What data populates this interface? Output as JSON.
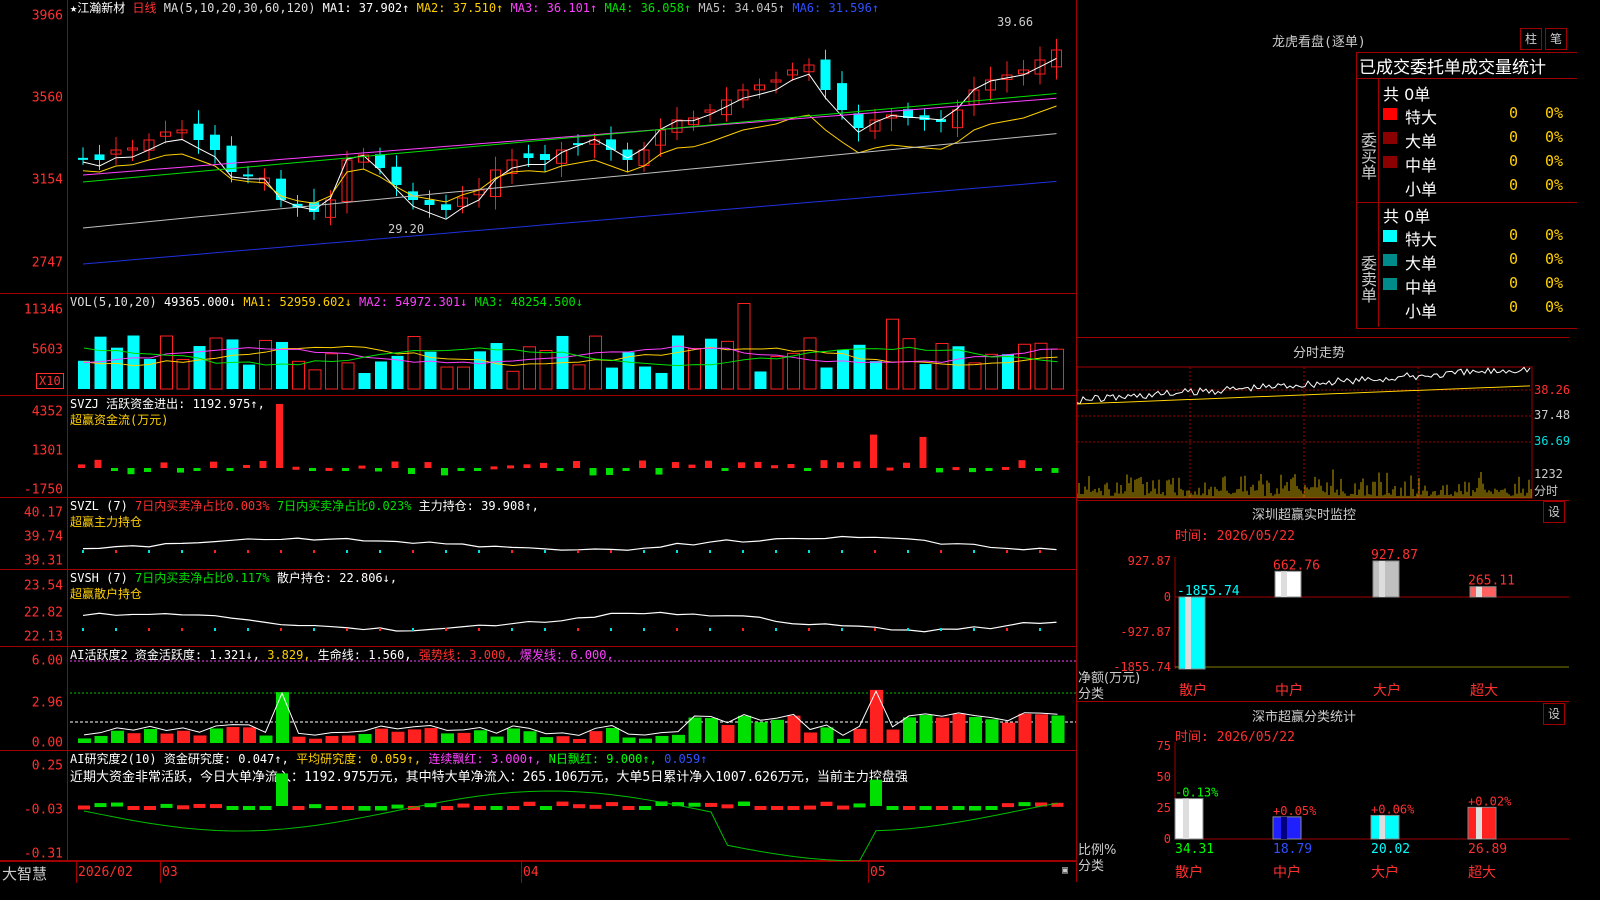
{
  "stock": {
    "name": "★江瀚新材",
    "period": "日线",
    "ma_label": "MA(5,10,20,30,60,120)",
    "ma1": "MA1: 37.902↑",
    "ma2": "MA2: 37.510↑",
    "ma3": "MA3: 36.101↑",
    "ma4": "MA4: 36.058↑",
    "ma5": "MA5: 34.045↑",
    "ma6": "MA6: 31.596↑",
    "max_label": "39.66",
    "min_label": "29.20"
  },
  "price_axis": [
    "3966",
    "3560",
    "3154",
    "2747"
  ],
  "vol": {
    "label": "VOL(5,10,20)",
    "v": "49365.000↓",
    "ma1": "MA1: 52959.602↓",
    "ma2": "MA2: 54972.301↓",
    "ma3": "MA3: 48254.500↓",
    "axis": [
      "11346",
      "5603"
    ],
    "x10": "X10"
  },
  "svzj": {
    "label": "SVZJ  活跃资金进出: 1192.975↑,",
    "sub": "超赢资金流(万元)",
    "axis": [
      "4352",
      "1301",
      "-1750"
    ]
  },
  "svzl": {
    "label": "SVZL (7)",
    "part1": "7日内买卖净占比0.003%",
    "part2": "7日内买卖净占比0.023%",
    "part3": "主力持仓: 39.908↑,",
    "sub": "超赢主力持仓",
    "axis": [
      "40.17",
      "39.74",
      "39.31"
    ]
  },
  "svsh": {
    "label": "SVSH (7)",
    "part1": "7日内买卖净占比0.117%",
    "part2": "散户持仓: 22.806↓,",
    "sub": "超赢散户持仓",
    "axis": [
      "23.54",
      "22.82",
      "22.13"
    ]
  },
  "ai1": {
    "label": "AI活跃度2",
    "p1": "资金活跃度: 1.321↓,",
    "p2": "3.829,",
    "p3": "生命线: 1.560,",
    "p4": "强势线: 3.000,",
    "p5": "爆发线: 6.000,",
    "axis": [
      "6.00",
      "2.96",
      "0.00"
    ]
  },
  "ai2": {
    "label": "AI研究度2(10)",
    "p1": "资金研究度: 0.047↑,",
    "p2": "平均研究度: 0.059↑,",
    "p3": "连续飘红: 3.000↑,",
    "p4": "N日飘红: 9.000↑,",
    "p5": "0.059↑",
    "text": "近期大资金非常活跃，今日大单净流入：1192.975万元，其中特大单净流入：265.106万元，大单5日累计净入1007.626万元，当前主力控盘强",
    "axis": [
      "0.25",
      "-0.03",
      "-0.31"
    ]
  },
  "footer": {
    "brand": "大智慧",
    "d1": "2026/02",
    "d2": "03",
    "d3": "04",
    "d4": "05"
  },
  "lhb": {
    "title": "龙虎看盘(逐单)",
    "btn1": "柱",
    "btn2": "笔",
    "heading": "已成交委托单成交量统计",
    "buy_side": "委买单",
    "sell_side": "委卖单",
    "buy_total": "共 0单",
    "sell_total": "共 0单",
    "buy_rows": [
      {
        "label": "特大",
        "v": "0",
        "p": "0%",
        "color": "#ff0000"
      },
      {
        "label": "大单",
        "v": "0",
        "p": "0%",
        "color": "#8b0000"
      },
      {
        "label": "中单",
        "v": "0",
        "p": "0%",
        "color": "#8b0000"
      },
      {
        "label": "小单",
        "v": "0",
        "p": "0%",
        "color": "#000000"
      }
    ],
    "sell_rows": [
      {
        "label": "特大",
        "v": "0",
        "p": "0%",
        "color": "#00ffff"
      },
      {
        "label": "大单",
        "v": "0",
        "p": "0%",
        "color": "#008b8b"
      },
      {
        "label": "中单",
        "v": "0",
        "p": "0%",
        "color": "#008b8b"
      },
      {
        "label": "小单",
        "v": "0",
        "p": "0%",
        "color": "#000000"
      }
    ]
  },
  "fenshi": {
    "title": "分时走势",
    "axis": [
      "38.26",
      "37.48",
      "36.69",
      "1232",
      "分时"
    ]
  },
  "sz_monitor": {
    "title": "深圳超赢实时监控",
    "btn": "设",
    "time": "时间: 2026/05/22",
    "axis": [
      "927.87",
      "0",
      "-927.87",
      "-1855.74"
    ],
    "ylab": "净额(万元)",
    "xlab": "分类",
    "cats": [
      "散户",
      "中户",
      "大户",
      "超大"
    ],
    "values": [
      -1855.74,
      662.76,
      927.87,
      265.11
    ],
    "labels": [
      "-1855.74",
      "662.76",
      "927.87",
      "265.11"
    ]
  },
  "sz_class": {
    "title": "深市超赢分类统计",
    "btn": "设",
    "time": "时间: 2026/05/22",
    "axis": [
      "75",
      "50",
      "25",
      "0"
    ],
    "ylab": "比例%",
    "xlab": "分类",
    "cats": [
      "散户",
      "中户",
      "大户",
      "超大"
    ],
    "values": [
      34.31,
      18.79,
      20.02,
      26.89
    ],
    "pct": [
      "-0.13%",
      "+0.05%",
      "+0.06%",
      "+0.02%"
    ],
    "labels": [
      "34.31",
      "18.79",
      "20.02",
      "26.89"
    ]
  }
}
